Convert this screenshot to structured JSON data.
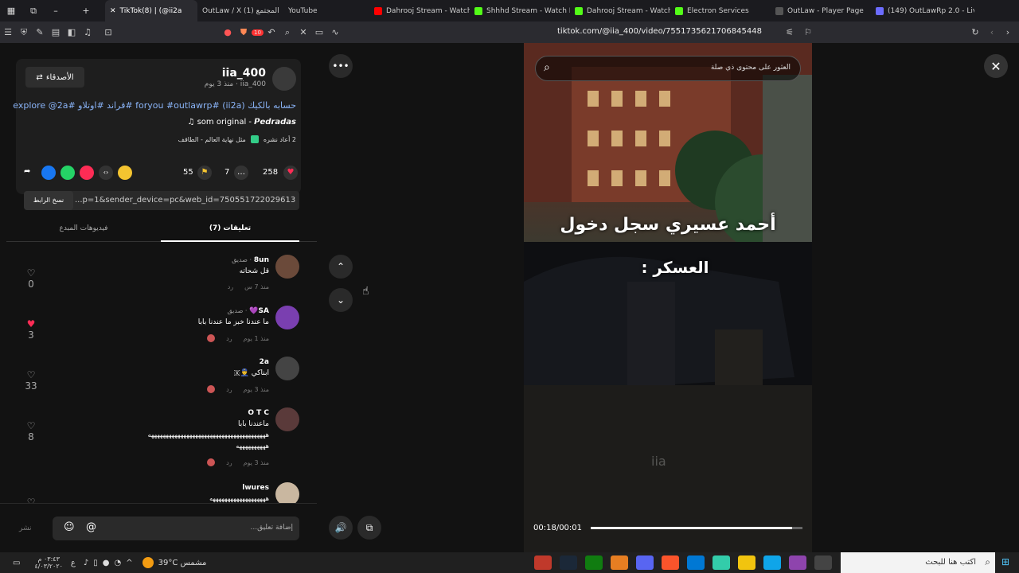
{
  "browser": {
    "tabs": [
      {
        "label": "TikTok(8) | (@ii2a",
        "color": "#ffffff"
      },
      {
        "label": "OutLaw / X المجتمع (1)",
        "color": "#e6e6e6"
      },
      {
        "label": "YouTube",
        "color": "#ff0000"
      },
      {
        "label": "Dahrooj Stream - Watch L",
        "color": "#53fc18"
      },
      {
        "label": "Shhhd Stream - Watch Live",
        "color": "#53fc18"
      },
      {
        "label": "Dahrooj Stream - Watch L",
        "color": "#53fc18"
      },
      {
        "label": "Electron Services",
        "color": "#888888"
      },
      {
        "label": "OutLaw - Player Page",
        "color": "#6c6cff"
      },
      {
        "label": "(149) OutLawRp 2.0 - Live",
        "color": "#53fc18"
      }
    ],
    "url": "tiktok.com/@iia_400/video/7551735621706845448",
    "badge_count": "10"
  },
  "post": {
    "username": "iia_400",
    "handle_time": "iia_400 · منذ 3 يوم",
    "friends_button": "الأصدقاء",
    "caption": "حسابه بالكيك (ii2a) #foryou #outlawrp #قراند #اوتلاو #explore @2a",
    "sound": "som original - 𝙋𝙚𝙙𝙧𝙖𝙙𝙖𝙨",
    "reposts": "2 أعاد نشره",
    "effect": "مثل نهاية العالم - الطاقف",
    "likes": "258",
    "comments": "7",
    "saves": "55",
    "link": "...p=1&sender_device=pc&web_id=7505517220296132151",
    "copy_link": "نسخ الرابط",
    "tab_comments": "تعليقات (7)",
    "tab_creator": "فيديوهات المبدع"
  },
  "comments": [
    {
      "name": "8un",
      "tag": "· صديق",
      "text": "قل شحاته",
      "time": "منذ 7 س",
      "reply": "رد",
      "likes": "0",
      "liked": false,
      "avatar": "#6b4a3a"
    },
    {
      "name": "SA💜",
      "tag": "· صديق",
      "text": "ما عندنا خبز ما عندنا بابا",
      "time": "منذ 1 يوم",
      "reply": "رد",
      "likes": "3",
      "liked": true,
      "avatar": "#7a3fb0"
    },
    {
      "name": "2a",
      "tag": "",
      "text": "ابناكي 👮‍♂️🇽",
      "time": "منذ 3 يوم",
      "reply": "رد",
      "likes": "33",
      "liked": false,
      "avatar": "#444444"
    },
    {
      "name": "O T C",
      "tag": "",
      "text": "ماعندنا بابا",
      "text2": "ههههههههههههههههههههههههههههههههههههههههه",
      "text3": "ههههههههههه",
      "time": "منذ 3 يوم",
      "reply": "رد",
      "likes": "8",
      "liked": false,
      "avatar": "#5a3a3a"
    },
    {
      "name": "lwures",
      "tag": "",
      "text": "هههههههههههههههههههه",
      "time": "",
      "reply": "",
      "likes": "",
      "liked": false,
      "avatar": "#c9b7a0"
    }
  ],
  "input": {
    "placeholder": "إضافة تعليق...",
    "post": "نشر"
  },
  "video": {
    "search_placeholder": "العثور على محتوى ذي صلة",
    "caption_line1": "أحمد عسيري سجل دخول",
    "caption_line2": "العسكر :",
    "time": "00:18/00:01",
    "watermark": "iia",
    "progress": 0.95
  },
  "taskbar": {
    "search": "اكتب هنا للبحث",
    "weather": "39°C مشمس",
    "time": "٠٣:٤٣ م",
    "date": "٤/٠٣/٢٠٢٠",
    "lang": "ع"
  }
}
